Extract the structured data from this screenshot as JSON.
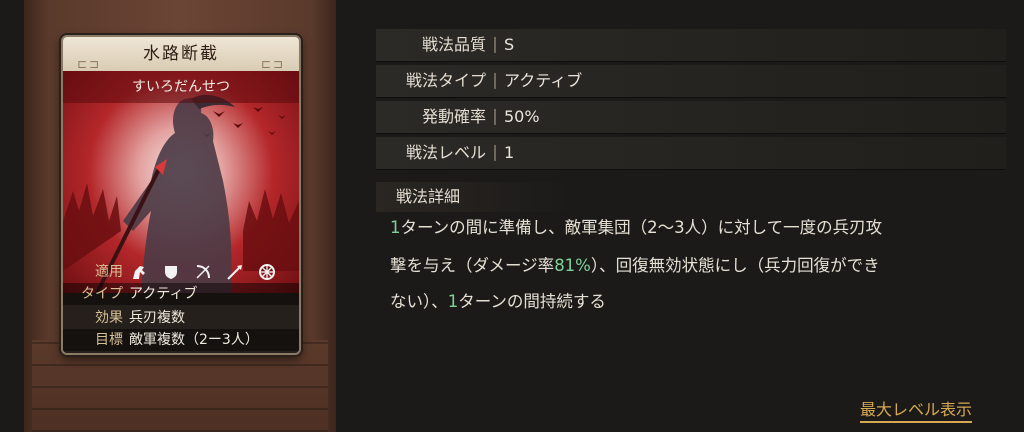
{
  "card": {
    "name": "水路断截",
    "reading": "すいろだんせつ",
    "applicable_label": "適用",
    "applicable_icons": [
      "cavalry-icon",
      "shield-icon",
      "bow-icon",
      "spear-icon",
      "wheel-icon"
    ],
    "type_label": "タイプ",
    "type_value": "アクティブ",
    "effect_label": "効果",
    "effect_value": "兵刃複数",
    "target_label": "目標",
    "target_value": "敵軍複数（2ー3人）"
  },
  "stats": [
    {
      "label": "戦法品質",
      "value": "S"
    },
    {
      "label": "戦法タイプ",
      "value": "アクティブ"
    },
    {
      "label": "発動確率",
      "value": "50%"
    },
    {
      "label": "戦法レベル",
      "value": "1"
    }
  ],
  "detail": {
    "title": "戦法詳細",
    "line1": {
      "a": "1",
      "b": "ターンの間に準備し、敵軍集団（2〜3人）に対して一度の兵刃攻"
    },
    "line2": {
      "a": "撃を与え（ダメージ率",
      "b": "81%",
      "c": "）、回復無効状態にし（兵力回復ができ"
    },
    "line3": {
      "a": "ない）、",
      "b": "1",
      "c": "ターンの間持続する"
    }
  },
  "max_level_link": "最大レベル表示",
  "colors": {
    "highlight_green": "#7fd19a",
    "link_gold": "#d5a952",
    "card_red": "#b4272a"
  }
}
